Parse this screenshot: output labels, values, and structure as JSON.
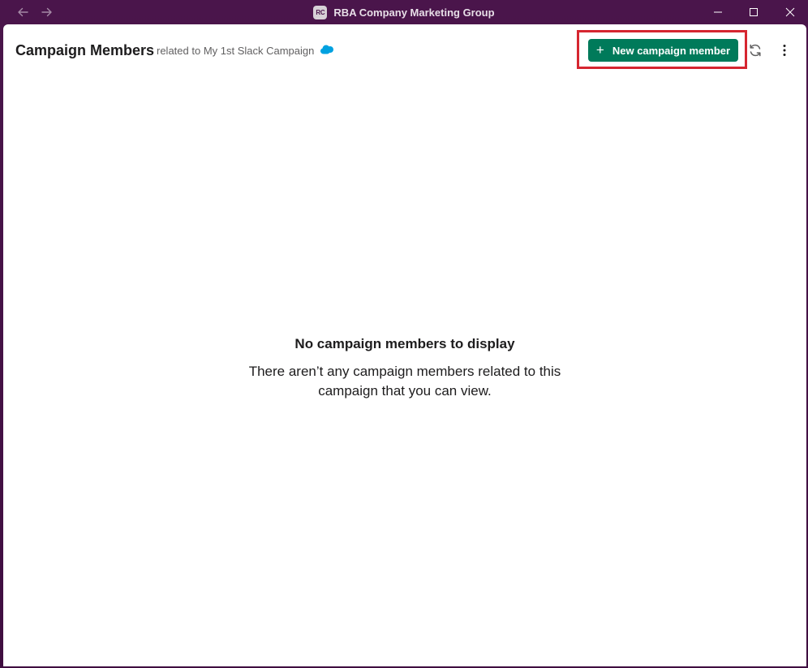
{
  "window": {
    "workspace_badge": "RC",
    "title": "RBA Company Marketing Group"
  },
  "header": {
    "title": "Campaign Members",
    "related_text": "related to My 1st Slack Campaign",
    "new_button_label": "New campaign member",
    "plus_glyph": "+"
  },
  "empty_state": {
    "title": "No campaign members to display",
    "description": "There aren’t any campaign members related to this campaign that you can view."
  },
  "colors": {
    "titlebar": "#4a154b",
    "primary_button": "#007a5a",
    "highlight": "#d62630",
    "salesforce": "#00a1e0"
  },
  "icons": [
    "arrow-left-icon",
    "arrow-right-icon",
    "minimize-icon",
    "maximize-icon",
    "close-icon",
    "salesforce-cloud-icon",
    "plus-icon",
    "refresh-icon",
    "more-vertical-icon"
  ]
}
